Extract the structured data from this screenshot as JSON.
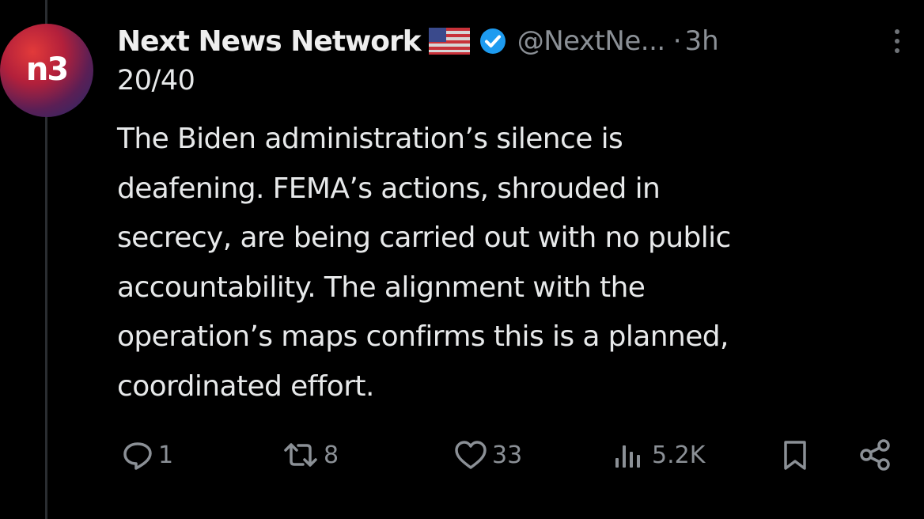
{
  "tweet": {
    "author_name": "Next News Network",
    "avatar_text": "n3",
    "handle": "@NextNe...",
    "separator": "·",
    "time": "3h",
    "counter": "20/40",
    "lines": [
      "The Biden administration’s silence is",
      "deafening. FEMA’s actions, shrouded in",
      "secrecy, are being carried out with no public",
      "accountability. The alignment with the",
      "operation’s maps confirms this is a planned,",
      "coordinated effort."
    ]
  },
  "actions": {
    "replies": "1",
    "reposts": "8",
    "likes": "33",
    "views": "5.2K"
  },
  "icons": {
    "flag": "us-flag-icon",
    "verified": "verified-badge-icon",
    "more": "more-icon",
    "reply": "reply-icon",
    "repost": "repost-icon",
    "like": "heart-icon",
    "views": "views-icon",
    "bookmark": "bookmark-icon",
    "share": "share-icon"
  },
  "colors": {
    "background": "#000000",
    "text": "#e7e9ea",
    "secondary": "#8b9096",
    "verified": "#1d9bf0"
  }
}
